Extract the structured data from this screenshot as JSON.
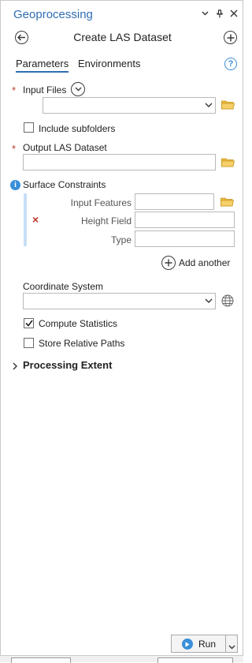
{
  "panel": {
    "title": "Geoprocessing",
    "tool_title": "Create LAS Dataset",
    "icons": {
      "menu": "chevron-down-icon",
      "pin": "pin-icon",
      "close": "close-icon",
      "back": "back-arrow-icon",
      "add": "add-circle-icon",
      "help": "help-icon",
      "folder": "folder-icon",
      "globe": "globe-icon"
    },
    "accent_color": "#2f6db5"
  },
  "tabs": [
    {
      "label": "Parameters",
      "active": true
    },
    {
      "label": "Environments",
      "active": false
    }
  ],
  "help_glyph": "?",
  "params": {
    "required_marker": "*",
    "input_files": {
      "label": "Input Files",
      "value": ""
    },
    "include_subfolders": {
      "label": "Include subfolders",
      "checked": false
    },
    "output_las": {
      "label": "Output LAS Dataset",
      "value": ""
    },
    "surface_constraints": {
      "label": "Surface Constraints",
      "info_glyph": "i",
      "remove_glyph": "×",
      "input_features_label": "Input Features",
      "height_field_label": "Height Field",
      "type_label": "Type",
      "add_another_label": "Add another"
    },
    "coordinate_system": {
      "label": "Coordinate System",
      "value": ""
    },
    "compute_statistics": {
      "label": "Compute Statistics",
      "checked": true
    },
    "store_relative_paths": {
      "label": "Store Relative Paths",
      "checked": false
    },
    "processing_extent": {
      "label": "Processing Extent"
    }
  },
  "run_button": {
    "label": "Run"
  }
}
